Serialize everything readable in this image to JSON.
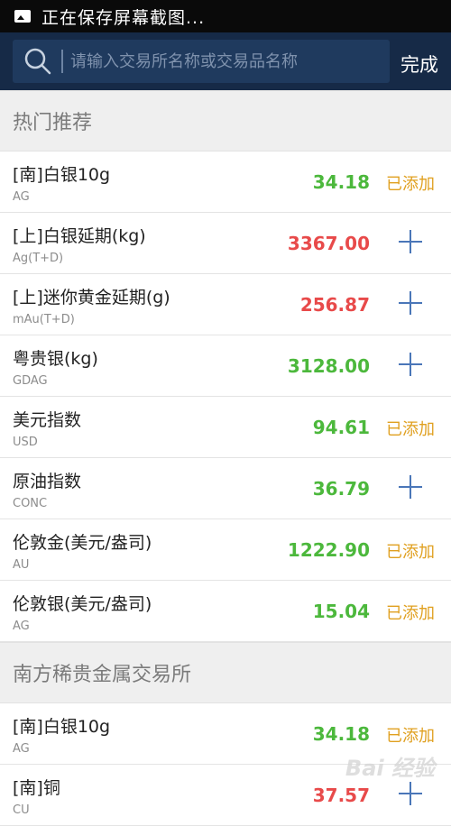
{
  "status_bar": {
    "text": "正在保存屏幕截图..."
  },
  "search": {
    "placeholder": "请输入交易所名称或交易品名称",
    "done_label": "完成"
  },
  "sections": [
    {
      "title": "热门推荐"
    },
    {
      "title": "南方稀贵金属交易所"
    }
  ],
  "rows": [
    {
      "name": "[南]白银10g",
      "code": "AG",
      "price": "34.18",
      "price_color": "#4cb83c",
      "status": "已添加"
    },
    {
      "name": "[上]白银延期(kg)",
      "code": "Ag(T+D)",
      "price": "3367.00",
      "price_color": "#e84a4a",
      "status": ""
    },
    {
      "name": "[上]迷你黄金延期(g)",
      "code": "mAu(T+D)",
      "price": "256.87",
      "price_color": "#e84a4a",
      "status": ""
    },
    {
      "name": "粤贵银(kg)",
      "code": "GDAG",
      "price": "3128.00",
      "price_color": "#4cb83c",
      "status": ""
    },
    {
      "name": "美元指数",
      "code": "USD",
      "price": "94.61",
      "price_color": "#4cb83c",
      "status": "已添加"
    },
    {
      "name": "原油指数",
      "code": "CONC",
      "price": "36.79",
      "price_color": "#4cb83c",
      "status": ""
    },
    {
      "name": "伦敦金(美元/盎司)",
      "code": "AU",
      "price": "1222.90",
      "price_color": "#4cb83c",
      "status": "已添加"
    },
    {
      "name": "伦敦银(美元/盎司)",
      "code": "AG",
      "price": "15.04",
      "price_color": "#4cb83c",
      "status": "已添加"
    },
    {
      "name": "[南]白银10g",
      "code": "AG",
      "price": "34.18",
      "price_color": "#4cb83c",
      "status": "已添加"
    },
    {
      "name": "[南]铜",
      "code": "CU",
      "price": "37.57",
      "price_color": "#e84a4a",
      "status": ""
    }
  ],
  "watermark": "Bai 经验",
  "icons": {
    "search": "search-icon",
    "add": "plus-icon",
    "image": "image-icon"
  }
}
